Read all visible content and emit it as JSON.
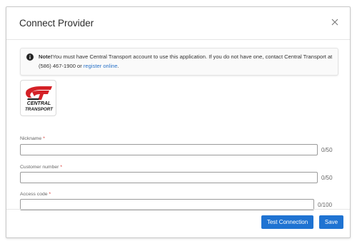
{
  "modal": {
    "title": "Connect Provider"
  },
  "notice": {
    "bold": "Note!",
    "text": "You must have Central Transport account to use this application. If you do not have one, contact Central Transport at (586) 467-1900 or ",
    "link": "register online",
    "suffix": "."
  },
  "logo": {
    "line1": "CENTRAL",
    "line2": "TRANSPORT",
    "brand_red": "#d42127",
    "brand_dark": "#1a1a1a"
  },
  "fields": {
    "nickname": {
      "label": "Nickname",
      "required": "*",
      "value": "",
      "counter": "0/50"
    },
    "customer_number": {
      "label": "Customer number",
      "required": "*",
      "value": "",
      "counter": "0/50"
    },
    "access_code": {
      "label": "Access code",
      "required": "*",
      "value": "",
      "counter": "0/100"
    }
  },
  "footer": {
    "test_label": "Test Connection",
    "save_label": "Save"
  },
  "colors": {
    "accent": "#1f73d2",
    "required": "#d9322e",
    "link": "#2a73c8"
  }
}
